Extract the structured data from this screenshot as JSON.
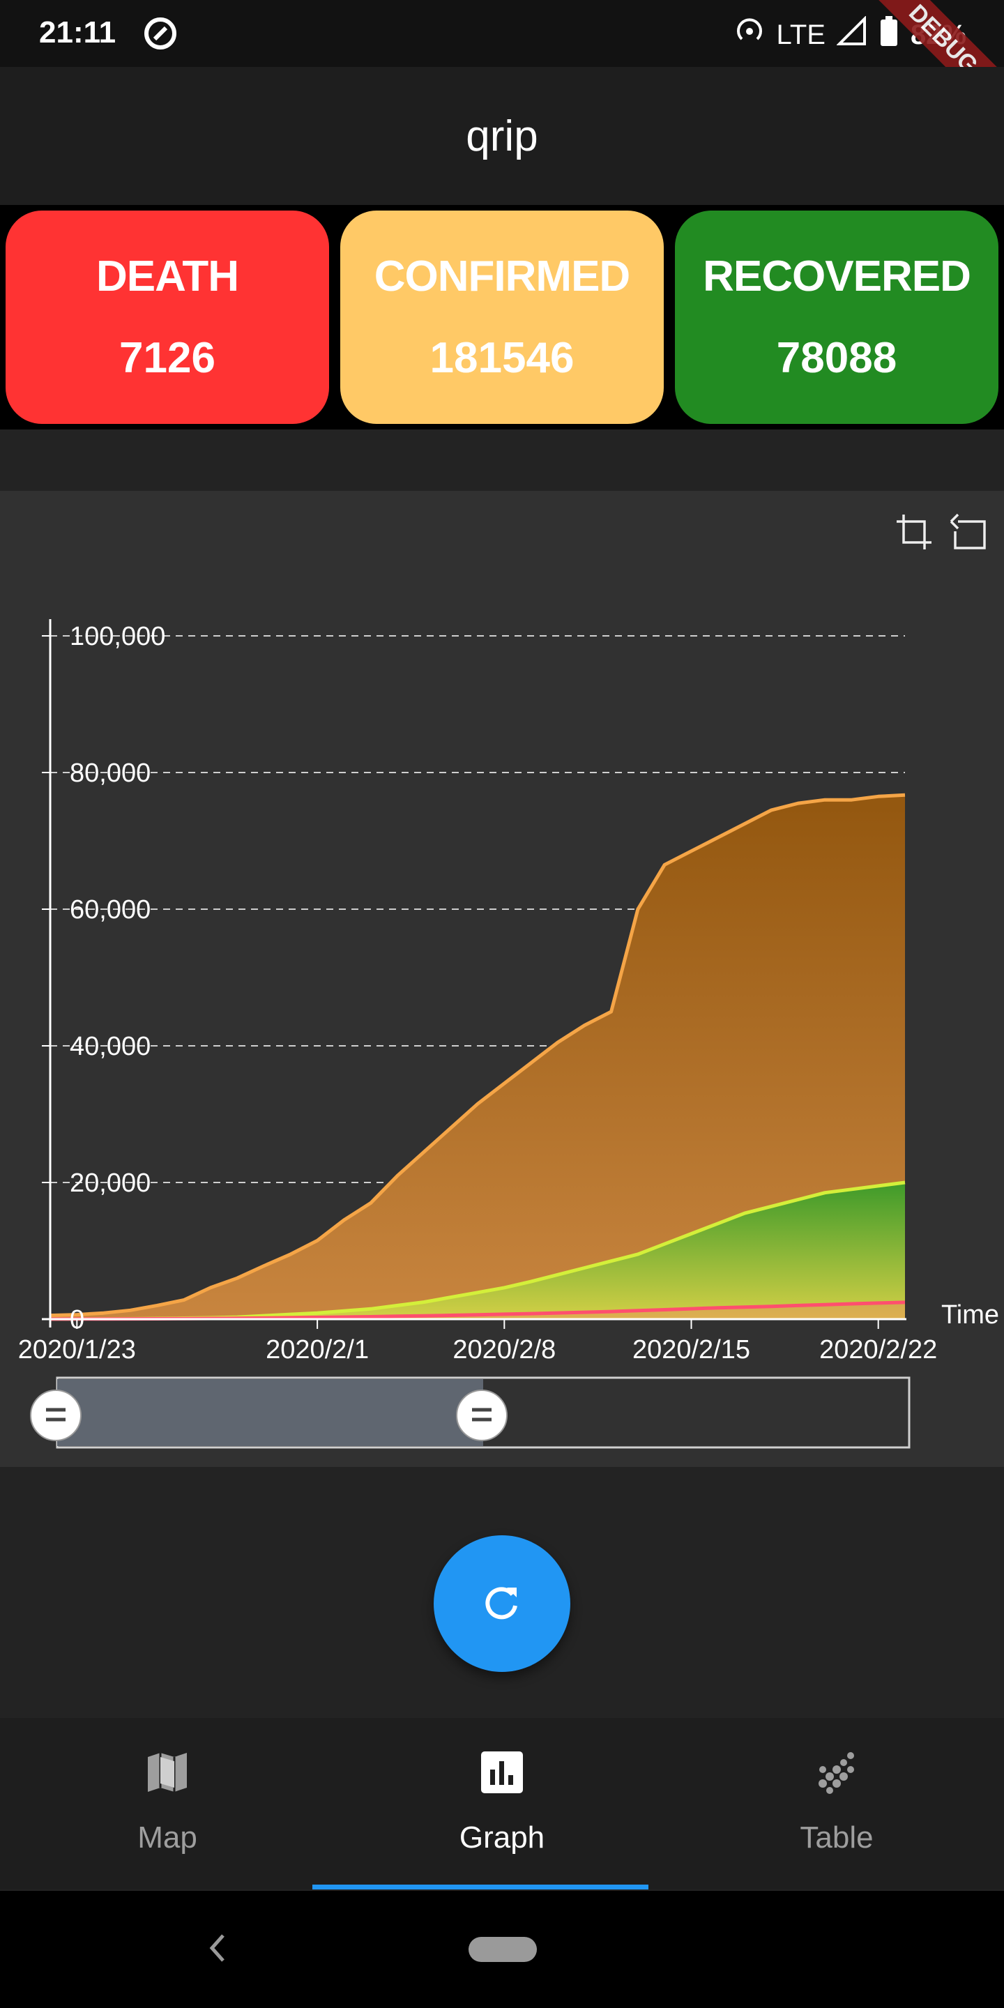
{
  "status_bar": {
    "time": "21:11",
    "network": "LTE",
    "battery": "82%",
    "debug_label": "DEBUG"
  },
  "app_bar": {
    "title": "qrip"
  },
  "stats": [
    {
      "label": "DEATH",
      "value": "7126",
      "color": "#ff3333"
    },
    {
      "label": "CONFIRMED",
      "value": "181546",
      "color": "#ffc966"
    },
    {
      "label": "RECOVERED",
      "value": "78088",
      "color": "#228b22"
    }
  ],
  "chart_toolbar": {
    "icons": [
      "crop-icon",
      "undo-icon"
    ]
  },
  "chart_data": {
    "type": "area",
    "xlabel": "Time",
    "ylabel": "",
    "ylim": [
      0,
      100000
    ],
    "y_ticks": [
      "0",
      "20,000",
      "40,000",
      "60,000",
      "80,000",
      "100,000"
    ],
    "x_ticks": [
      "2020/1/23",
      "2020/2/1",
      "2020/2/8",
      "2020/2/15",
      "2020/2/22"
    ],
    "grid": true,
    "x": [
      "2020/1/22",
      "2020/1/23",
      "2020/1/24",
      "2020/1/25",
      "2020/1/26",
      "2020/1/27",
      "2020/1/28",
      "2020/1/29",
      "2020/1/30",
      "2020/1/31",
      "2020/2/1",
      "2020/2/2",
      "2020/2/3",
      "2020/2/4",
      "2020/2/5",
      "2020/2/6",
      "2020/2/7",
      "2020/2/8",
      "2020/2/9",
      "2020/2/10",
      "2020/2/11",
      "2020/2/12",
      "2020/2/13",
      "2020/2/14",
      "2020/2/15",
      "2020/2/16",
      "2020/2/17",
      "2020/2/18",
      "2020/2/19",
      "2020/2/20",
      "2020/2/21",
      "2020/2/22",
      "2020/2/23"
    ],
    "series": [
      {
        "color": "#f5a547",
        "values": [
          550,
          650,
          900,
          1300,
          2000,
          2800,
          4600,
          6000,
          7800,
          9500,
          11500,
          14500,
          17000,
          21000,
          24500,
          28000,
          31500,
          34500,
          37500,
          40500,
          43000,
          45000,
          60000,
          66500,
          68500,
          70500,
          72500,
          74500,
          75500,
          76000,
          76000,
          76500,
          76700
        ]
      },
      {
        "color": "#d4ef3a",
        "values": [
          30,
          40,
          50,
          60,
          100,
          150,
          200,
          300,
          500,
          700,
          900,
          1200,
          1500,
          2000,
          2500,
          3200,
          3900,
          4600,
          5500,
          6500,
          7500,
          8500,
          9500,
          11000,
          12500,
          14000,
          15500,
          16500,
          17500,
          18500,
          19000,
          19500,
          20000
        ]
      },
      {
        "color": "#ff4f6e",
        "values": [
          15,
          18,
          25,
          40,
          55,
          80,
          105,
          130,
          165,
          210,
          255,
          305,
          360,
          425,
          490,
          560,
          635,
          720,
          810,
          910,
          1010,
          1115,
          1260,
          1380,
          1520,
          1665,
          1770,
          1870,
          2005,
          2120,
          2240,
          2360,
          2460
        ]
      }
    ],
    "range_slider": {
      "start": 0.0,
      "end": 0.5
    }
  },
  "fab": {
    "icon": "refresh-icon"
  },
  "bottom_nav": {
    "items": [
      {
        "label": "Map",
        "icon": "map-icon",
        "active": false
      },
      {
        "label": "Graph",
        "icon": "bar-chart-icon",
        "active": true
      },
      {
        "label": "Table",
        "icon": "grain-icon",
        "active": false
      }
    ],
    "active_color": "#2196f3"
  }
}
